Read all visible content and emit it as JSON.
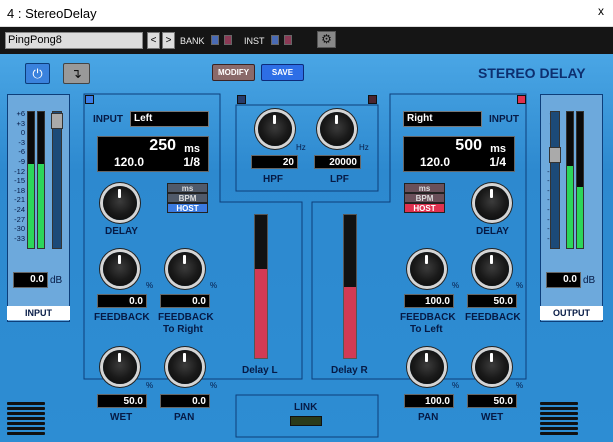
{
  "window": {
    "title": "4 : StereoDelay",
    "close": "x"
  },
  "toolbar": {
    "preset": "PingPong8",
    "prev": "<",
    "next": ">",
    "bank_label": "BANK",
    "inst_label": "INST",
    "gear": "⚙"
  },
  "header": {
    "power": "⏻",
    "route": "↴",
    "modify": "MODIFY",
    "save": "SAVE",
    "brand": "STEREO DELAY"
  },
  "meters": {
    "scale": [
      "+6",
      "+3",
      "0",
      "-3",
      "-6",
      "-9",
      "-12",
      "-15",
      "-18",
      "-21",
      "-24",
      "-27",
      "-30",
      "-33"
    ],
    "input": {
      "label": "INPUT",
      "gain": "0.0",
      "unit": "dB",
      "level_l": 0.62,
      "level_r": 0.62
    },
    "output": {
      "label": "OUTPUT",
      "gain": "0.0",
      "unit": "dB",
      "level_l": 0.6,
      "level_r": 0.45
    }
  },
  "left": {
    "input_label": "INPUT",
    "channel": "Left",
    "time_value": "250",
    "time_unit": "ms",
    "bpm": "120.0",
    "note": "1/8",
    "modes": [
      "ms",
      "BPM",
      "HOST"
    ],
    "delay_label": "DELAY",
    "feedback_label": "FEEDBACK",
    "feedback": "0.0",
    "cross_label_1": "FEEDBACK",
    "cross_label_2": "To Right",
    "cross": "0.0",
    "wet_label": "WET",
    "wet": "50.0",
    "pan_label": "PAN",
    "pan": "0.0",
    "pct": "%"
  },
  "right": {
    "input_label": "INPUT",
    "channel": "Right",
    "time_value": "500",
    "time_unit": "ms",
    "bpm": "120.0",
    "note": "1/4",
    "modes": [
      "ms",
      "BPM",
      "HOST"
    ],
    "delay_label": "DELAY",
    "feedback_label": "FEEDBACK",
    "feedback": "50.0",
    "cross_label_1": "FEEDBACK",
    "cross_label_2": "To Left",
    "cross": "100.0",
    "wet_label": "WET",
    "wet": "50.0",
    "pan_label": "PAN",
    "pan": "100.0",
    "pct": "%"
  },
  "filters": {
    "hpf_label": "HPF",
    "hpf": "20",
    "lpf_label": "LPF",
    "lpf": "20000",
    "unit": "Hz"
  },
  "delay_meters": {
    "left_label": "Delay L",
    "right_label": "Delay R",
    "left_level": 0.62,
    "right_level": 0.5
  },
  "link": {
    "label": "LINK"
  }
}
